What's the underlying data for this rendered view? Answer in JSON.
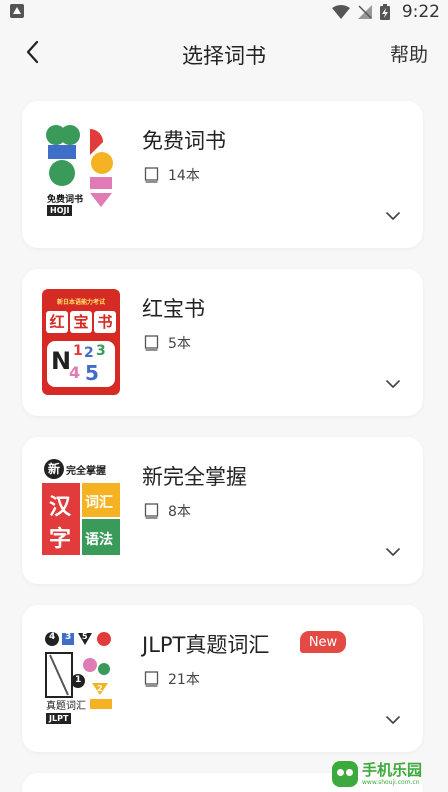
{
  "status_bar": {
    "time": "9:22"
  },
  "header": {
    "title": "选择词书",
    "help_label": "帮助"
  },
  "books": [
    {
      "title": "免费词书",
      "count": "14本",
      "cover_text": [
        "免费词书",
        "HOJI"
      ]
    },
    {
      "title": "红宝书",
      "count": "5本",
      "cover_text": [
        "新日本语能力考试",
        "红",
        "宝",
        "书",
        "N",
        "1",
        "2",
        "3",
        "4",
        "5"
      ]
    },
    {
      "title": "新完全掌握",
      "count": "8本",
      "cover_text": [
        "新",
        "完全掌握",
        "汉",
        "字",
        "词汇",
        "语法"
      ]
    },
    {
      "title": "JLPT真题词汇",
      "count": "21本",
      "badge": "New",
      "cover_text": [
        "4",
        "3",
        "5",
        "1",
        "2",
        "真题词汇",
        "JLPT"
      ]
    }
  ],
  "watermark": {
    "name": "手机乐园",
    "url": "www.shouji.com.cn"
  },
  "colors": {
    "background": "#f7f7f7",
    "card": "#ffffff",
    "badge": "#e44a44",
    "watermark": "#3caa3c"
  }
}
